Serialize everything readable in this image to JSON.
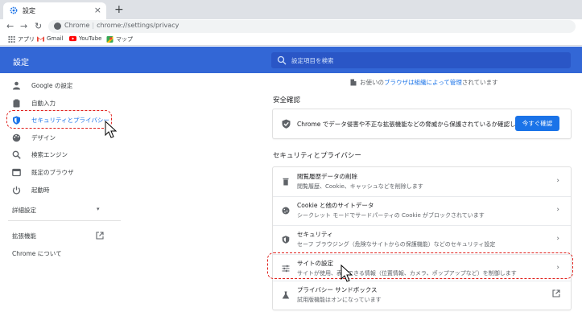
{
  "browser": {
    "tab_title": "設定",
    "tab_close": "×",
    "new_tab": "+",
    "back": "←",
    "forward": "→",
    "reload": "↻",
    "url_site": "Chrome",
    "url_separator": "|",
    "url_path": "chrome://settings/privacy",
    "bookmarks": [
      {
        "label": "アプリ",
        "icon": "apps-grid-icon"
      },
      {
        "label": "Gmail",
        "icon": "gmail-icon"
      },
      {
        "label": "YouTube",
        "icon": "youtube-icon"
      },
      {
        "label": "マップ",
        "icon": "maps-icon"
      }
    ]
  },
  "header": {
    "title": "設定",
    "search_placeholder": "設定項目を検索"
  },
  "sidebar": {
    "items": [
      {
        "label": "Google の設定",
        "icon": "person-icon"
      },
      {
        "label": "自動入力",
        "icon": "clipboard-icon"
      },
      {
        "label": "セキュリティとプライバシー",
        "icon": "shield-icon"
      },
      {
        "label": "デザイン",
        "icon": "palette-icon"
      },
      {
        "label": "検索エンジン",
        "icon": "search-icon"
      },
      {
        "label": "既定のブラウザ",
        "icon": "browser-icon"
      },
      {
        "label": "起動時",
        "icon": "power-icon"
      }
    ],
    "advanced": "詳細設定",
    "advanced_arrow": "▾",
    "extensions": "拡張機能",
    "about": "Chrome について"
  },
  "main": {
    "managed_prefix": "お使いの",
    "managed_link1": "ブラウザは組織によって管理",
    "managed_suffix": "されています",
    "safety_heading": "安全確認",
    "safety_text": "Chrome でデータ侵害や不正な拡張機能などの脅威から保護されているか確認します",
    "safety_button": "今すぐ確認",
    "privacy_heading": "セキュリティとプライバシー",
    "rows": [
      {
        "title": "閲覧履歴データの削除",
        "subtitle": "閲覧履歴、Cookie、キャッシュなどを削除します",
        "icon": "trash-icon",
        "action": "›"
      },
      {
        "title": "Cookie と他のサイトデータ",
        "subtitle": "シークレット モードでサードパーティの Cookie がブロックされています",
        "icon": "cookie-icon",
        "action": "›"
      },
      {
        "title": "セキュリティ",
        "subtitle": "セーフ ブラウジング（危険なサイトからの保護機能）などのセキュリティ設定",
        "icon": "shield-icon",
        "action": "›"
      },
      {
        "title": "サイトの設定",
        "subtitle": "サイトが使用、表示できる情報（位置情報、カメラ、ポップアップなど）を制御します",
        "icon": "sliders-icon",
        "action": "›"
      },
      {
        "title": "プライバシー サンドボックス",
        "subtitle": "試用版機能はオンになっています",
        "icon": "flask-icon",
        "action": "external-link-icon"
      }
    ]
  },
  "colors": {
    "header_bg": "#3367d6",
    "accent": "#1a73e8",
    "highlight": "#e0201c"
  }
}
